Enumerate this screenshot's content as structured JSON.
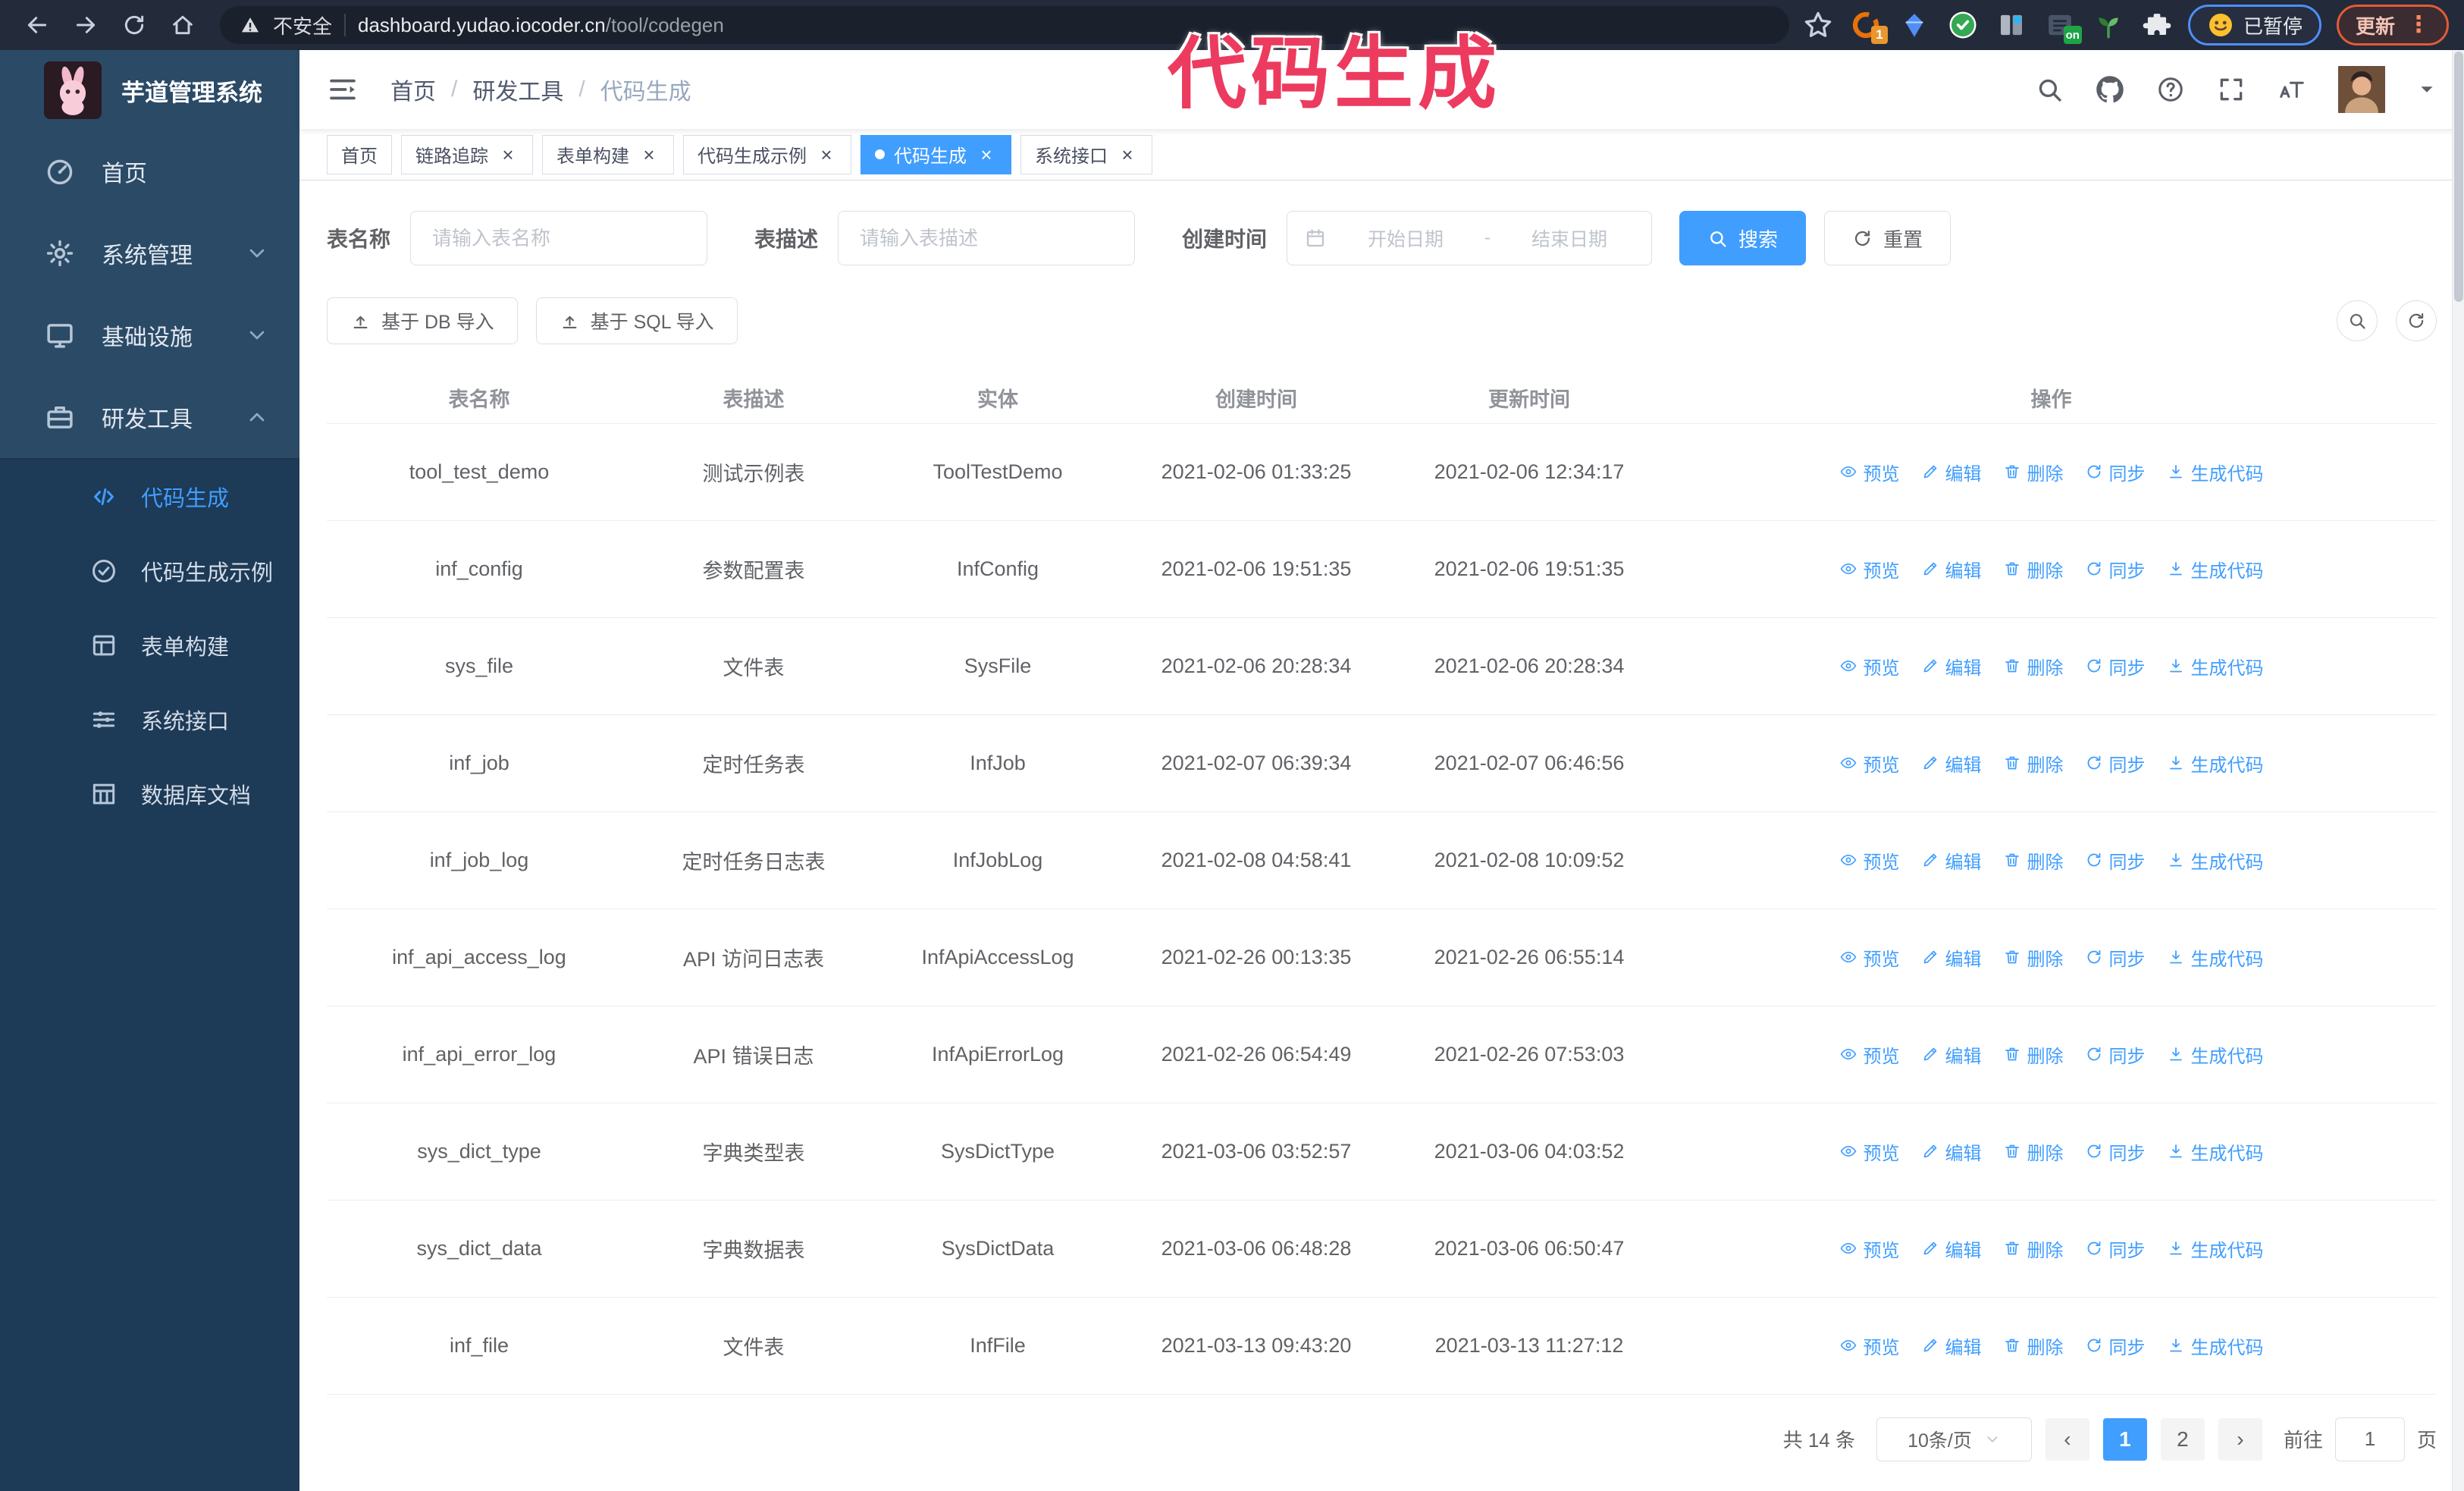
{
  "browser": {
    "nav_icons": [
      "back-arrow-icon",
      "forward-arrow-icon",
      "reload-icon",
      "home-icon"
    ],
    "security_text": "不安全",
    "url_host": "dashboard.yudao.iocoder.cn",
    "url_path": "/tool/codegen",
    "extensions": [
      {
        "icon": "orange-ring-extension-icon",
        "badge": "1"
      },
      {
        "icon": "gem-extension-icon"
      },
      {
        "icon": "green-check-extension-icon"
      },
      {
        "icon": "sliders-extension-icon"
      },
      {
        "icon": "dark-box-extension-icon",
        "badge": "on"
      },
      {
        "icon": "plant-extension-icon"
      },
      {
        "icon": "puzzle-extensions-icon"
      }
    ],
    "paused_label": "已暂停",
    "update_label": "更新"
  },
  "annotation": {
    "text": "代码生成"
  },
  "sidebar": {
    "logo_title": "芋道管理系统",
    "items": [
      {
        "id": "home",
        "label": "首页",
        "icon": "dashboard-icon"
      },
      {
        "id": "system",
        "label": "系统管理",
        "icon": "gear-icon",
        "chevron": "down"
      },
      {
        "id": "infra",
        "label": "基础设施",
        "icon": "monitor-icon",
        "chevron": "down"
      },
      {
        "id": "devtool",
        "label": "研发工具",
        "icon": "toolbox-icon",
        "chevron": "up",
        "children": [
          {
            "id": "codegen",
            "label": "代码生成",
            "icon": "code-icon",
            "active": true
          },
          {
            "id": "codegen-example",
            "label": "代码生成示例",
            "icon": "example-icon"
          },
          {
            "id": "form-build",
            "label": "表单构建",
            "icon": "form-icon"
          },
          {
            "id": "system-api",
            "label": "系统接口",
            "icon": "api-icon"
          },
          {
            "id": "db-doc",
            "label": "数据库文档",
            "icon": "database-doc-icon"
          }
        ]
      }
    ]
  },
  "header": {
    "breadcrumb": [
      "首页",
      "研发工具",
      "代码生成"
    ],
    "right_icons": [
      "search-icon",
      "github-icon",
      "help-icon",
      "fullscreen-icon",
      "font-size-icon"
    ]
  },
  "tags": [
    {
      "label": "首页",
      "closable": false,
      "active": false
    },
    {
      "label": "链路追踪",
      "closable": true,
      "active": false
    },
    {
      "label": "表单构建",
      "closable": true,
      "active": false
    },
    {
      "label": "代码生成示例",
      "closable": true,
      "active": false
    },
    {
      "label": "代码生成",
      "closable": true,
      "active": true
    },
    {
      "label": "系统接口",
      "closable": true,
      "active": false
    }
  ],
  "filters": {
    "name_label": "表名称",
    "name_placeholder": "请输入表名称",
    "desc_label": "表描述",
    "desc_placeholder": "请输入表描述",
    "date_label": "创建时间",
    "date_start_placeholder": "开始日期",
    "date_separator": "-",
    "date_end_placeholder": "结束日期",
    "search_label": "搜索",
    "reset_label": "重置"
  },
  "toolbar": {
    "import_db_label": "基于 DB 导入",
    "import_sql_label": "基于 SQL 导入",
    "corner_icons": [
      "magnifier-icon",
      "refresh-icon"
    ]
  },
  "table": {
    "columns": [
      "表名称",
      "表描述",
      "实体",
      "创建时间",
      "更新时间",
      "操作"
    ],
    "actions": [
      {
        "label": "预览",
        "icon": "eye-icon"
      },
      {
        "label": "编辑",
        "icon": "edit-icon"
      },
      {
        "label": "删除",
        "icon": "delete-icon"
      },
      {
        "label": "同步",
        "icon": "sync-icon"
      },
      {
        "label": "生成代码",
        "icon": "generate-code-icon"
      }
    ],
    "rows": [
      {
        "name": "tool_test_demo",
        "desc": "测试示例表",
        "entity": "ToolTestDemo",
        "created": "2021-02-06 01:33:25",
        "updated": "2021-02-06 12:34:17"
      },
      {
        "name": "inf_config",
        "desc": "参数配置表",
        "entity": "InfConfig",
        "created": "2021-02-06 19:51:35",
        "updated": "2021-02-06 19:51:35"
      },
      {
        "name": "sys_file",
        "desc": "文件表",
        "entity": "SysFile",
        "created": "2021-02-06 20:28:34",
        "updated": "2021-02-06 20:28:34"
      },
      {
        "name": "inf_job",
        "desc": "定时任务表",
        "entity": "InfJob",
        "created": "2021-02-07 06:39:34",
        "updated": "2021-02-07 06:46:56"
      },
      {
        "name": "inf_job_log",
        "desc": "定时任务日志表",
        "entity": "InfJobLog",
        "created": "2021-02-08 04:58:41",
        "updated": "2021-02-08 10:09:52"
      },
      {
        "name": "inf_api_access_log",
        "desc": "API 访问日志表",
        "entity": "InfApiAccessLog",
        "created": "2021-02-26 00:13:35",
        "updated": "2021-02-26 06:55:14"
      },
      {
        "name": "inf_api_error_log",
        "desc": "API 错误日志",
        "entity": "InfApiErrorLog",
        "created": "2021-02-26 06:54:49",
        "updated": "2021-02-26 07:53:03"
      },
      {
        "name": "sys_dict_type",
        "desc": "字典类型表",
        "entity": "SysDictType",
        "created": "2021-03-06 03:52:57",
        "updated": "2021-03-06 04:03:52"
      },
      {
        "name": "sys_dict_data",
        "desc": "字典数据表",
        "entity": "SysDictData",
        "created": "2021-03-06 06:48:28",
        "updated": "2021-03-06 06:50:47"
      },
      {
        "name": "inf_file",
        "desc": "文件表",
        "entity": "InfFile",
        "created": "2021-03-13 09:43:20",
        "updated": "2021-03-13 11:27:12"
      }
    ]
  },
  "pagination": {
    "total_text": "共 14 条",
    "page_size_text": "10条/页",
    "pages": [
      "1",
      "2"
    ],
    "active_page": "1",
    "goto_label": "前往",
    "goto_value": "1",
    "unit_label": "页"
  },
  "colors": {
    "accent": "#409eff",
    "annotation": "#ec3b5f",
    "sidebar_top": "#2b4a66",
    "sidebar_dark": "#1d3a57",
    "browser_bar": "#232a39"
  }
}
